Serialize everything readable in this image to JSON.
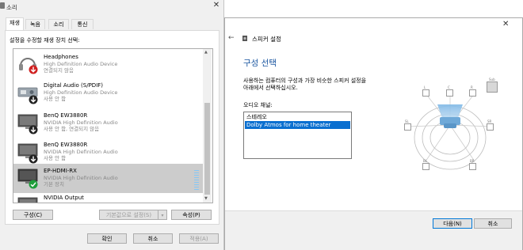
{
  "sound_dialog": {
    "title": "소리",
    "tabs": [
      {
        "label": "재생",
        "active": true
      },
      {
        "label": "녹음",
        "active": false
      },
      {
        "label": "소리",
        "active": false
      },
      {
        "label": "통신",
        "active": false
      }
    ],
    "instruction": "설정을 수정할 재생 장치 선택:",
    "devices": [
      {
        "name": "Headphones",
        "driver": "High Definition Audio Device",
        "status": "연결되지 않음",
        "icon": "headphones-icon",
        "badge": "red-down-arrow-icon"
      },
      {
        "name": "Digital Audio (S/PDIF)",
        "driver": "High Definition Audio Device",
        "status": "사용 안 함",
        "icon": "digital-audio-icon",
        "badge": "black-down-arrow-icon"
      },
      {
        "name": "BenQ EW3880R",
        "driver": "NVIDIA High Definition Audio",
        "status": "사용 안 함, 연결되지 않음",
        "icon": "monitor-icon",
        "badge": "black-down-arrow-icon"
      },
      {
        "name": "BenQ EW3880R",
        "driver": "NVIDIA High Definition Audio",
        "status": "사용 안 함",
        "icon": "monitor-icon",
        "badge": "black-down-arrow-icon"
      },
      {
        "name": "EP-HDMI-RX",
        "driver": "NVIDIA High Definition Audio",
        "status": "기본 장치",
        "icon": "monitor-icon",
        "badge": "green-check-icon",
        "selected": true
      },
      {
        "name": "NVIDIA Output",
        "driver": "",
        "status": "",
        "icon": "monitor-icon",
        "badge": ""
      }
    ],
    "buttons": {
      "configure": "구성(C)",
      "set_default": "기본값으로 설정(S)",
      "properties": "속성(P)",
      "ok": "확인",
      "cancel": "취소",
      "apply": "적용(A)"
    }
  },
  "speaker_setup": {
    "title": "스피커 설정",
    "heading": "구성 선택",
    "description_line1": "사용하는 컴퓨터의 구성과 가장 비슷한 스피커 설정을",
    "description_line2": "아래에서 선택하십시오.",
    "channel_label": "오디오 채널:",
    "channels": [
      {
        "label": "스테레오",
        "selected": false
      },
      {
        "label": "Dolby Atmos for home theater",
        "selected": true
      }
    ],
    "speaker_labels": [
      "L",
      "C",
      "R",
      "Sub",
      "SL",
      "SR",
      "BL",
      "BR"
    ],
    "buttons": {
      "next": "다음(N)",
      "cancel": "취소"
    },
    "accent_color": "#0a6fd0"
  }
}
